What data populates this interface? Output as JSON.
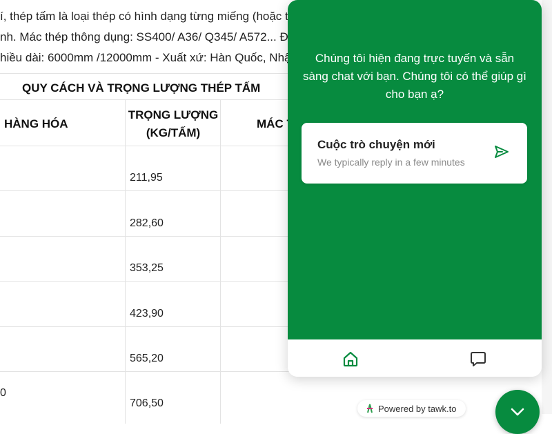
{
  "article": {
    "line1": "í, thép tấm là loại thép có hình dạng từng miếng (hoặc t",
    "line2": "nh. Mác thép thông dụng: SS400/ A36/ Q345/ A572... Đ",
    "line3": "hiều dài: 6000mm /12000mm - Xuất xứ: Hàn Quốc, Nhậ",
    "table_title": "QUY CÁCH VÀ TRỌNG LƯỢNG THÉP TẤM",
    "headers": {
      "goods": "HÀNG HÓA",
      "weight_line1": "TRỌNG LƯỢNG",
      "weight_line2": "(KG/TẤM)",
      "grade": "MÁC T"
    },
    "weights": [
      "211,95",
      "282,60",
      "353,25",
      "423,90",
      "565,20",
      "706,50"
    ],
    "edge_mark": "0"
  },
  "chat": {
    "greeting": "Chúng tôi hiện đang trực tuyến và sẵn sàng chat với bạn. Chúng tôi có thể giúp gì cho bạn ạ?",
    "card_title": "Cuộc trò chuyện mới",
    "card_subtitle": "We typically reply in a few minutes",
    "send_icon": "send-icon",
    "home_icon": "home-icon",
    "messages_icon": "message-icon",
    "powered_by": "Powered by tawk.to",
    "fab_icon": "chevron-down-icon",
    "accent_color": "#078b3f"
  }
}
